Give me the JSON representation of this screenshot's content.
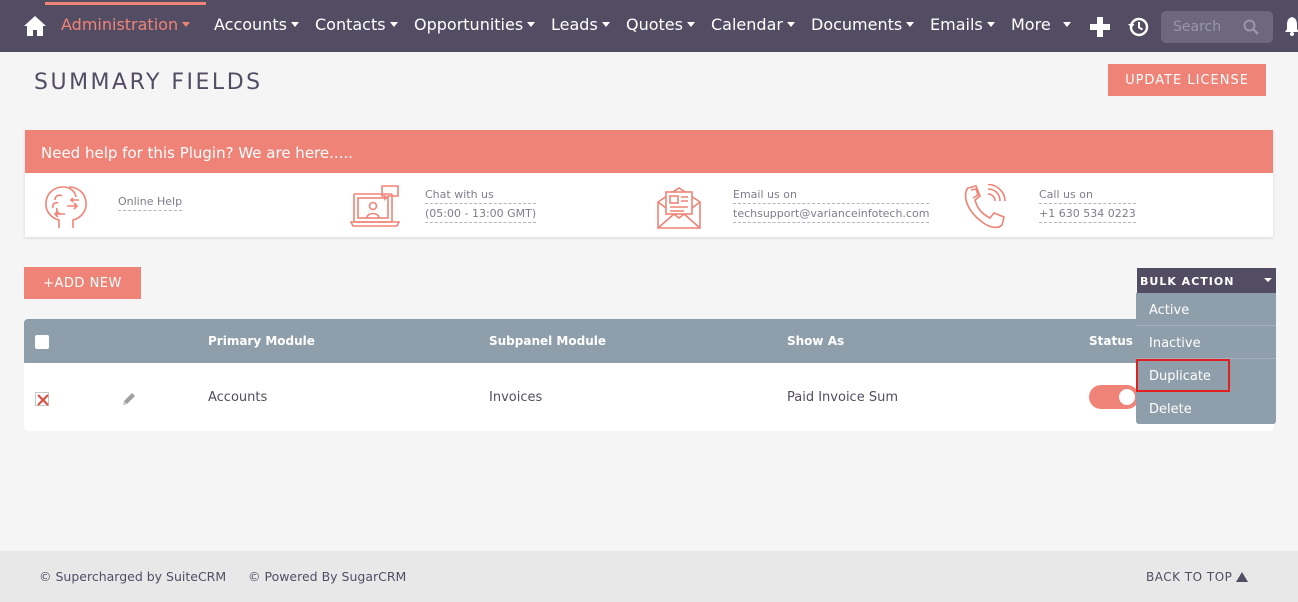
{
  "nav": {
    "items": [
      {
        "label": "Administration",
        "active": true
      },
      {
        "label": "Accounts"
      },
      {
        "label": "Contacts"
      },
      {
        "label": "Opportunities"
      },
      {
        "label": "Leads"
      },
      {
        "label": "Quotes"
      },
      {
        "label": "Calendar"
      },
      {
        "label": "Documents"
      },
      {
        "label": "Emails"
      },
      {
        "label": "More"
      }
    ],
    "search_placeholder": "Search",
    "icons": [
      "home-icon",
      "plus-icon",
      "history-icon",
      "search-icon",
      "bell-icon"
    ]
  },
  "page": {
    "title": "SUMMARY FIELDS",
    "update_license": "UPDATE LICENSE",
    "add_new": "+ADD NEW"
  },
  "help": {
    "header": "Need help for this Plugin? We are here.....",
    "items": [
      {
        "icon": "brain-head-icon",
        "lines": [
          "Online Help"
        ]
      },
      {
        "icon": "chat-laptop-icon",
        "lines": [
          "Chat with us",
          "(05:00 - 13:00 GMT)"
        ]
      },
      {
        "icon": "envelope-icon",
        "lines": [
          "Email us on",
          "techsupport@varianceinfotech.com"
        ]
      },
      {
        "icon": "phone-icon",
        "lines": [
          "Call us on",
          "+1 630 534 0223"
        ]
      }
    ]
  },
  "table": {
    "columns": [
      "Primary Module",
      "Subpanel Module",
      "Show As",
      "Status"
    ],
    "rows": [
      {
        "primary_module": "Accounts",
        "subpanel_module": "Invoices",
        "show_as": "Paid Invoice Sum",
        "status_on": true
      }
    ]
  },
  "bulk": {
    "label": "BULK ACTION",
    "options": [
      "Active",
      "Inactive",
      "Duplicate",
      "Delete"
    ],
    "highlighted": "Duplicate"
  },
  "footer": {
    "supercharged": "© Supercharged by SuiteCRM",
    "powered": "© Powered By SugarCRM",
    "back_to_top": "BACK TO TOP"
  },
  "colors": {
    "nav_bg": "#534d64",
    "accent": "#f08377",
    "table_header": "#8e9eab"
  }
}
